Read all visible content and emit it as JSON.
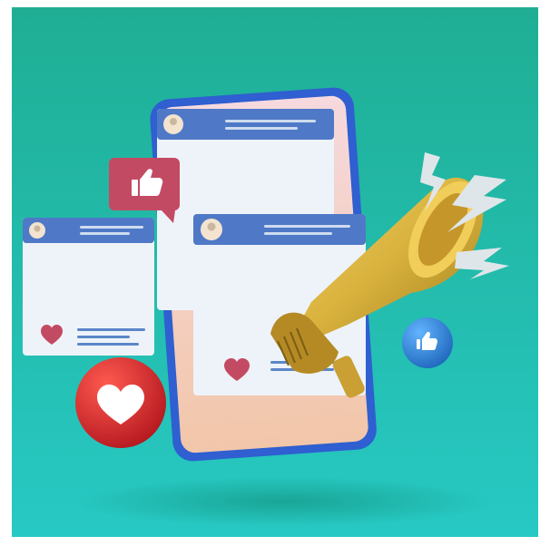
{
  "scene": {
    "description_tag": "social-media-marketing-illustration",
    "colors": {
      "background_top": "#1fae94",
      "background_bottom": "#27c9c4",
      "phone_frame": "#2f5fd0",
      "phone_screen_top": "#f6d9de",
      "phone_screen_bottom": "#f2c6a9",
      "post_header": "#4f79c7",
      "post_body": "#eef3f9",
      "like_badge": "#c34a63",
      "heart_ball": "#d6262c",
      "blue_like_ball": "#2f86db",
      "megaphone_gold": "#d9b23d",
      "lightning": "#dfe6ea"
    },
    "icons": [
      "thumbs-up-icon",
      "heart-icon",
      "avatar-icon",
      "megaphone-icon",
      "lightning-icon"
    ]
  }
}
